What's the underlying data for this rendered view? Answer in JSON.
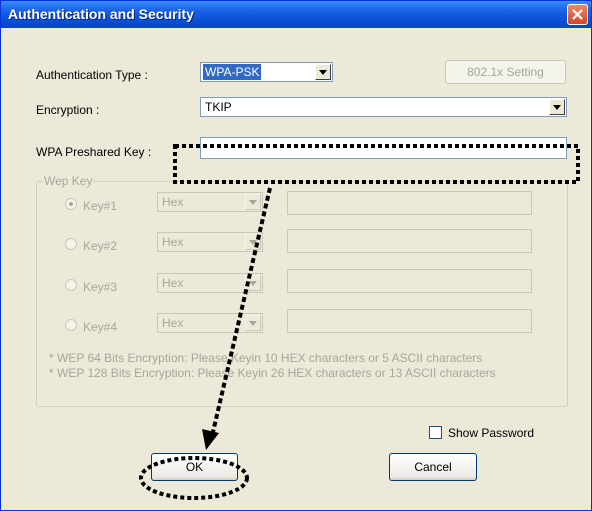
{
  "window": {
    "title": "Authentication and Security",
    "close_icon": "close-icon"
  },
  "auth_type": {
    "label": "Authentication Type :",
    "value": "WPA-PSK"
  },
  "setting_button": {
    "label": "802.1x Setting"
  },
  "encryption": {
    "label": "Encryption :",
    "value": "TKIP"
  },
  "preshared_key": {
    "label": "WPA Preshared Key :",
    "value": ""
  },
  "wep": {
    "legend": "Wep Key",
    "keys": [
      {
        "label": "Key#1",
        "format": "Hex",
        "value": "",
        "selected": true
      },
      {
        "label": "Key#2",
        "format": "Hex",
        "value": "",
        "selected": false
      },
      {
        "label": "Key#3",
        "format": "Hex",
        "value": "",
        "selected": false
      },
      {
        "label": "Key#4",
        "format": "Hex",
        "value": "",
        "selected": false
      }
    ],
    "notes": [
      "* WEP 64 Bits Encryption:  Please Keyin 10 HEX characters or 5 ASCII characters",
      "* WEP 128 Bits Encryption:  Please Keyin 26 HEX characters or 13 ASCII characters"
    ]
  },
  "show_password": {
    "label": "Show Password",
    "checked": false
  },
  "buttons": {
    "ok": "OK",
    "cancel": "Cancel"
  },
  "colors": {
    "titlebar": "#0a50d8",
    "dialog": "#ece9d8",
    "selection": "#316ac5",
    "annotation": "#000000"
  }
}
